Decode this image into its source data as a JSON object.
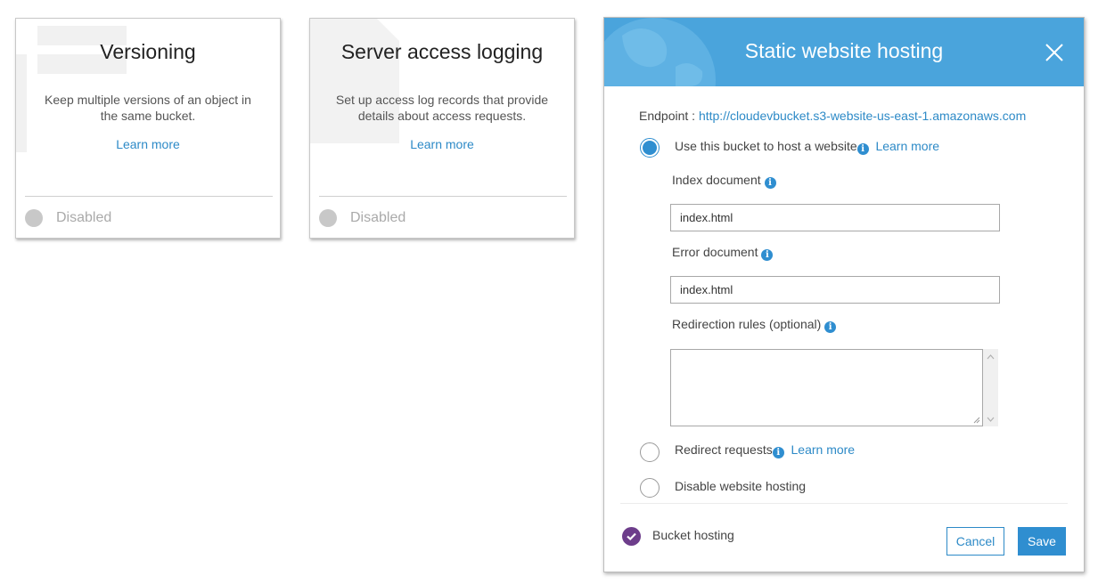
{
  "cards": [
    {
      "title": "Versioning",
      "description": "Keep multiple versions of an object in the same bucket.",
      "learn_more": "Learn more",
      "status": "Disabled"
    },
    {
      "title": "Server access logging",
      "description": "Set up access log records that provide details about access requests.",
      "learn_more": "Learn more",
      "status": "Disabled"
    }
  ],
  "modal": {
    "title": "Static website hosting",
    "header_color": "#4aa4dc",
    "endpoint_label": "Endpoint :",
    "endpoint_url": "http://cloudevbucket.s3-website-us-east-1.amazonaws.com",
    "options": [
      {
        "label": "Use this bucket to host a website",
        "learn_more": "Learn more",
        "selected": true
      },
      {
        "label": "Redirect requests",
        "learn_more": "Learn more",
        "selected": false
      },
      {
        "label": "Disable website hosting",
        "selected": false
      }
    ],
    "index_document": {
      "label": "Index document",
      "value": "index.html"
    },
    "error_document": {
      "label": "Error document",
      "value": "index.html"
    },
    "redirection_rules": {
      "label": "Redirection rules (optional)",
      "value": ""
    },
    "footer": {
      "status_label": "Bucket hosting",
      "status_color": "#6d3d8b",
      "cancel_label": "Cancel",
      "save_label": "Save"
    },
    "accent_color": "#2f8ed0"
  }
}
